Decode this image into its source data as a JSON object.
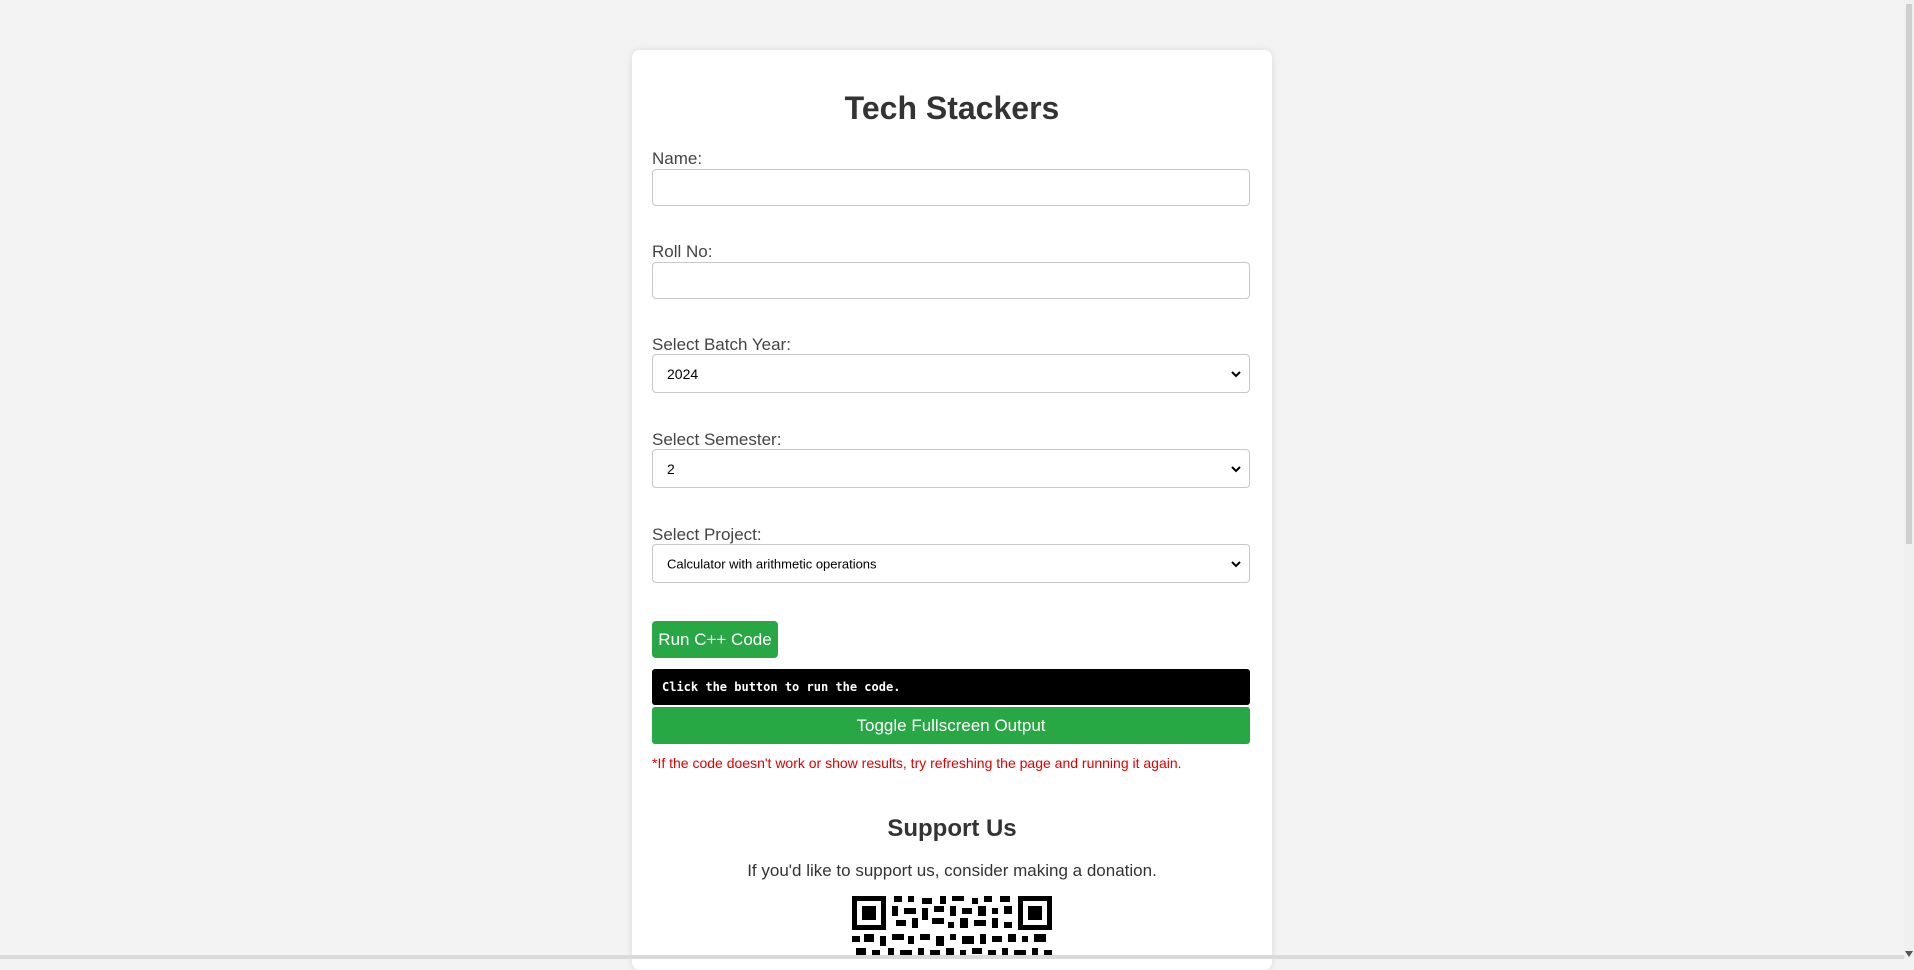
{
  "page": {
    "title": "Tech Stackers"
  },
  "form": {
    "name_label": "Name:",
    "name_value": "",
    "roll_label": "Roll No:",
    "roll_value": "",
    "batch_label": "Select Batch Year:",
    "batch_value": "2024",
    "semester_label": "Select Semester:",
    "semester_value": "2",
    "project_label": "Select Project:",
    "project_value": "Calculator with arithmetic operations"
  },
  "actions": {
    "run_label": "Run C++ Code",
    "output_text": "Click the button to run the code.",
    "toggle_label": "Toggle Fullscreen Output",
    "note": "*If the code doesn't work or show results, try refreshing the page and running it again."
  },
  "support": {
    "title": "Support Us",
    "text": "If you'd like to support us, consider making a donation."
  },
  "colors": {
    "accent_green": "#28a745",
    "note_red": "#e00000",
    "output_bg": "#000000"
  },
  "icons": {
    "select_chevron": "chevron-down-icon",
    "qr": "qr-code-icon"
  }
}
